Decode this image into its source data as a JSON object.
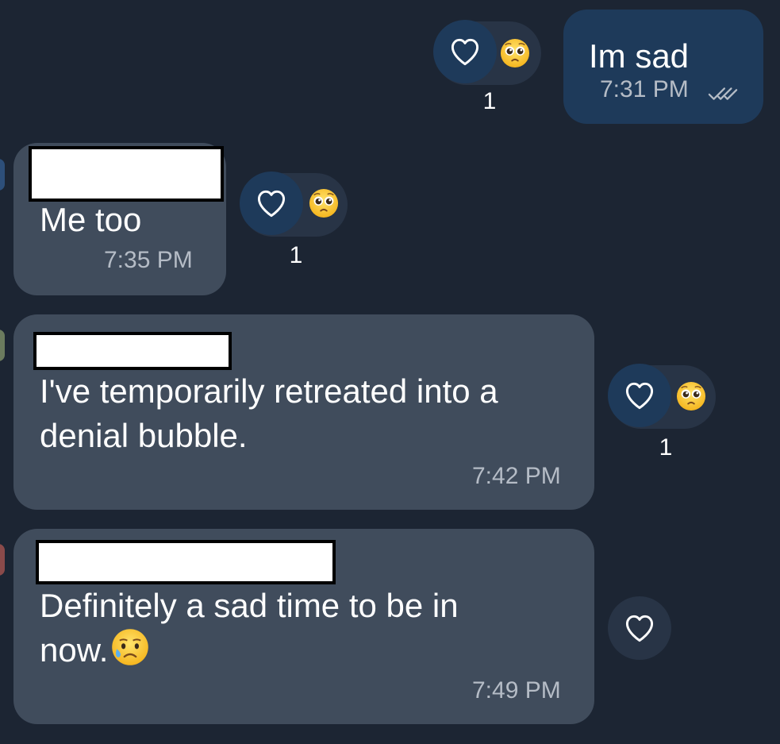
{
  "messages": [
    {
      "text": "Im sad",
      "time": "7:31 PM",
      "status": "read-double-check-icon",
      "reaction_count": "1"
    },
    {
      "text": "Me too",
      "time": "7:35 PM",
      "reaction_count": "1"
    },
    {
      "line1": "I've temporarily retreated into a",
      "line2": "denial bubble.",
      "time": "7:42 PM",
      "reaction_count": "1"
    },
    {
      "line1": "Definitely a sad time to be in",
      "line2": "now.",
      "time": "7:49 PM"
    }
  ],
  "icons": {
    "heart": "heart-outline-icon",
    "reaction_emoji": "pleading-face-emoji",
    "inline_emoji": "sad-but-relieved-face-emoji"
  },
  "colors": {
    "background": "#1c2533",
    "outgoing_bubble": "#1e3a5a",
    "incoming_bubble": "#404c5c",
    "reaction_pill": "#283446",
    "timestamp": "#b5bcc6"
  }
}
